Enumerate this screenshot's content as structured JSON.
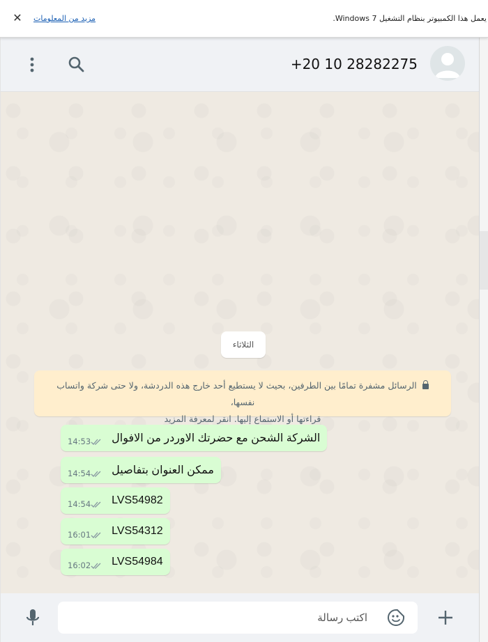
{
  "banner": {
    "message": "يعمل هذا الكمبيوتر بنظام التشغيل Windows 7.",
    "more_link": "مزيد من المعلومات",
    "close_glyph": "✕"
  },
  "header": {
    "contact_name": "+20 10 28282275",
    "icons": [
      "avatar-icon",
      "search-icon",
      "menu-icon"
    ]
  },
  "chat": {
    "date_label": "الثلاثاء",
    "encryption_notice": {
      "icon": "lock-icon",
      "line1": "الرسائل مشفرة تمامًا بين الطرفين، بحيث لا يستطيع أحد خارج هذه الدردشة، ولا حتى شركة واتساب نفسها،",
      "line2": "قراءتها أو الاستماع إليها. انقر لمعرفة المزيد"
    },
    "messages": [
      {
        "text": "الشركة الشحن مع حضرتك الاوردر من الافوال",
        "time": "14:53",
        "status": "read"
      },
      {
        "text": "ممكن العنوان بتفاصيل",
        "time": "14:54",
        "status": "read"
      },
      {
        "text": "LVS54982",
        "time": "14:54",
        "status": "read"
      },
      {
        "text": "LVS54312",
        "time": "16:01",
        "status": "read"
      },
      {
        "text": "LVS54984",
        "time": "16:02",
        "status": "read"
      }
    ]
  },
  "composer": {
    "placeholder": "اكتب رسالة",
    "value": "",
    "icons": [
      "mic-icon",
      "sticker-icon",
      "plus-icon"
    ]
  },
  "colors": {
    "outgoing_bubble": "#d9fdd3",
    "notice_bg": "#ffeecd",
    "header_bg": "#f0f2f5",
    "wallpaper_bg": "#efeae2",
    "tick_color": "#667781"
  }
}
